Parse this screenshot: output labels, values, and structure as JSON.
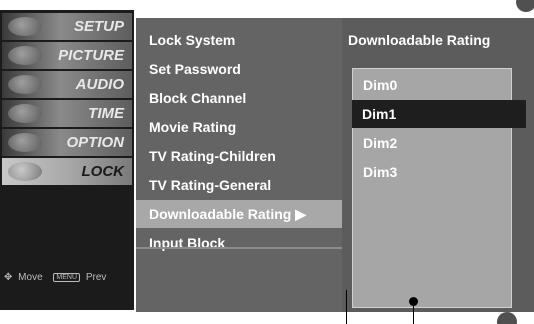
{
  "sidebar": {
    "categories": [
      {
        "label": "SETUP",
        "icon": "setup-icon"
      },
      {
        "label": "PICTURE",
        "icon": "picture-icon"
      },
      {
        "label": "AUDIO",
        "icon": "audio-icon"
      },
      {
        "label": "TIME",
        "icon": "time-icon"
      },
      {
        "label": "OPTION",
        "icon": "option-icon"
      },
      {
        "label": "LOCK",
        "icon": "lock-icon"
      }
    ],
    "selected_index": 5,
    "hint_move": "Move",
    "hint_prev_key": "MENU",
    "hint_prev": "Prev"
  },
  "menu": {
    "items": [
      "Lock System",
      "Set Password",
      "Block Channel",
      "Movie Rating",
      "TV Rating-Children",
      "TV Rating-General",
      "Downloadable Rating ▶",
      "Input Block"
    ],
    "selected_index": 6
  },
  "submenu": {
    "title": "Downloadable Rating",
    "options": [
      "Dim0",
      "Dim1",
      "Dim2",
      "Dim3"
    ],
    "selected_index": 1
  },
  "colors": {
    "menu_bg": "#646464",
    "highlight": "#a8a8a8",
    "selected_dark": "#1e1e1e"
  }
}
